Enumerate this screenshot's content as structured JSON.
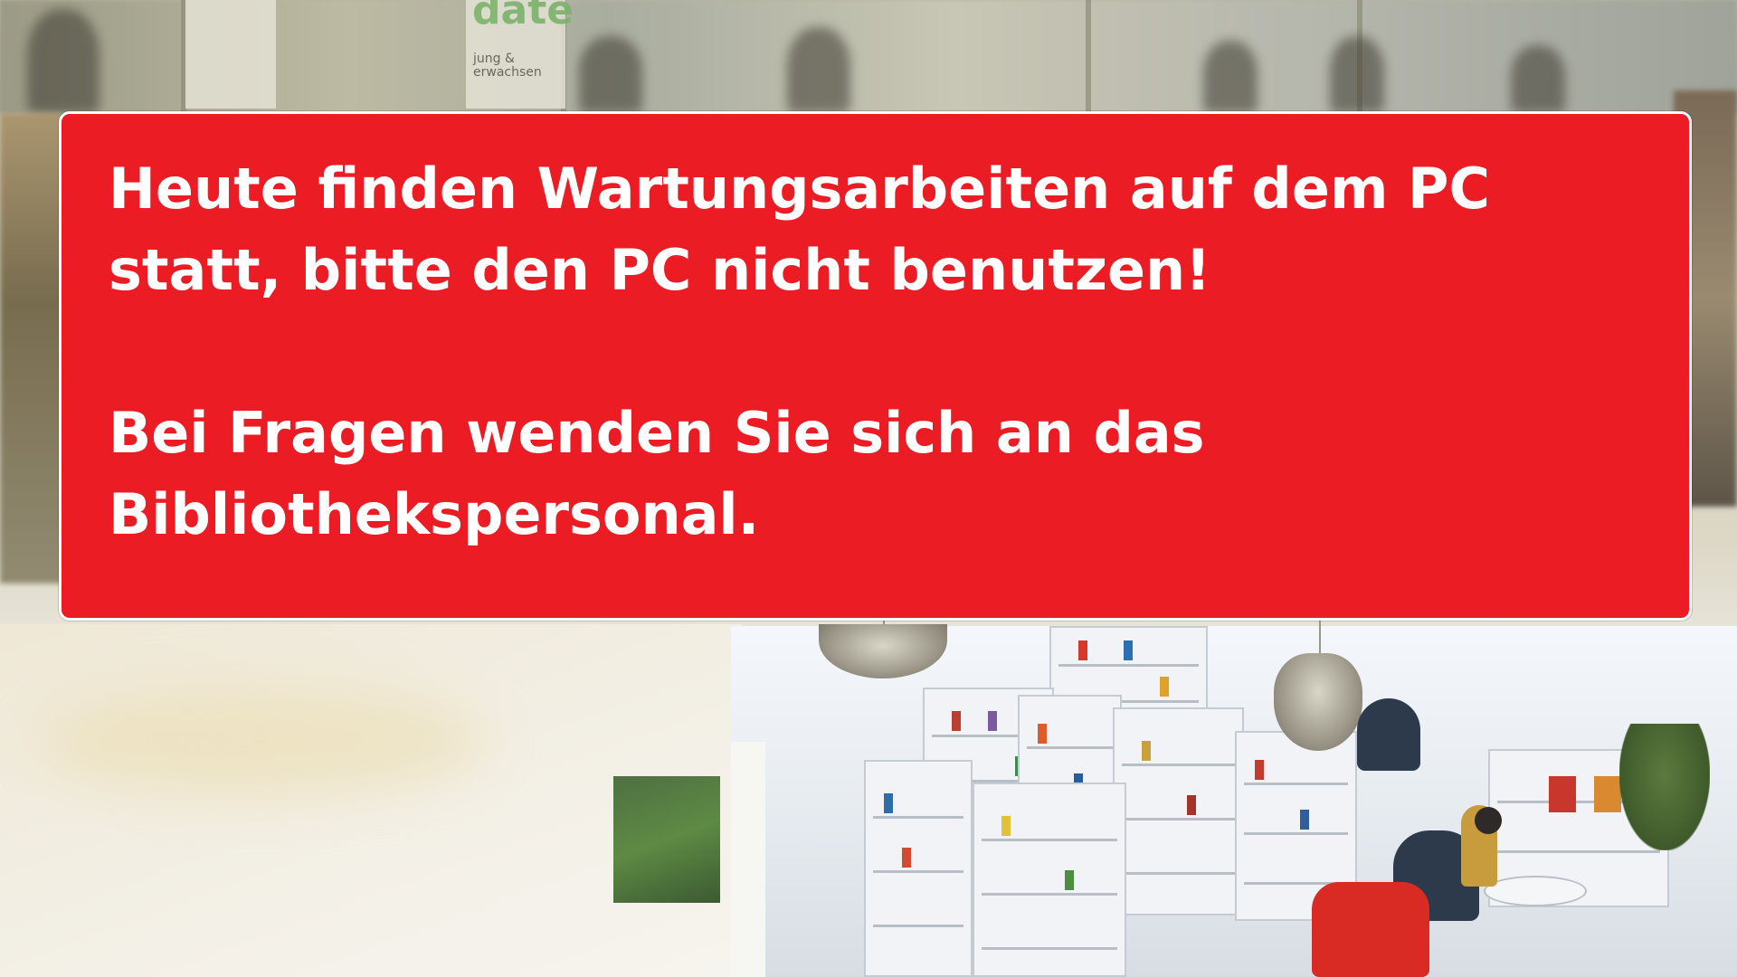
{
  "notice": {
    "message_line1": "Heute finden Wartungsarbeiten auf dem PC\nstatt, bitte den PC nicht benutzen!",
    "message_line2": "Bei Fragen wenden Sie sich an das\nBibliothekspersonal.",
    "background_color": "#ec1c24",
    "text_color": "#ffffff"
  },
  "background": {
    "poster_text": "jung & erwachsen",
    "scene": "library-interior-photo"
  }
}
